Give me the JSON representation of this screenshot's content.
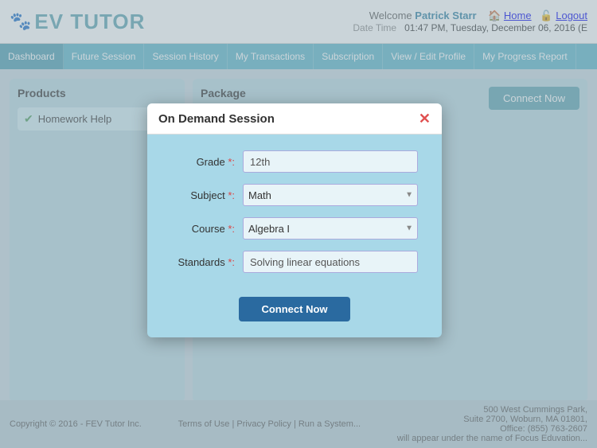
{
  "header": {
    "logo": "EV TUTOR",
    "welcome_label": "Welcome",
    "user_name": "Patrick Starr",
    "home_link": "Home",
    "logout_link": "Logout",
    "datetime_label": "Date Time",
    "datetime_value": "01:47 PM, Tuesday, December 06, 2016 (E"
  },
  "nav": {
    "items": [
      {
        "id": "dashboard",
        "label": "Dashboard"
      },
      {
        "id": "future-session",
        "label": "Future Session"
      },
      {
        "id": "session-history",
        "label": "Session History"
      },
      {
        "id": "my-transactions",
        "label": "My Transactions"
      },
      {
        "id": "subscription",
        "label": "Subscription"
      },
      {
        "id": "view-edit-profile",
        "label": "View / Edit Profile"
      },
      {
        "id": "my-progress-report",
        "label": "My Progress Report"
      }
    ]
  },
  "products_panel": {
    "title": "Products",
    "items": [
      {
        "id": "homework-help",
        "label": "Homework Help",
        "checked": true
      }
    ]
  },
  "package_panel": {
    "title": "Package",
    "connect_label": "Connect Now"
  },
  "modal": {
    "title": "On Demand Session",
    "close_icon": "✕",
    "fields": {
      "grade_label": "Grade",
      "grade_value": "12th",
      "subject_label": "Subject",
      "subject_value": "Math",
      "course_label": "Course",
      "course_value": "Algebra I",
      "standards_label": "Standards",
      "standards_value": "Solving linear equations"
    },
    "connect_label": "Connect Now",
    "required_marker": "*"
  },
  "footer": {
    "copyright": "Copyright © 2016 - FEV Tutor Inc.",
    "links": [
      "Terms of Use",
      "Privacy Policy",
      "Run a System..."
    ],
    "address": "500 West Cummings Park,",
    "address2": "Suite 2700, Woburn, MA 01801,",
    "phone": "Office: (855) 763-2607",
    "note": "will appear under the name of Focus Eduvation..."
  }
}
